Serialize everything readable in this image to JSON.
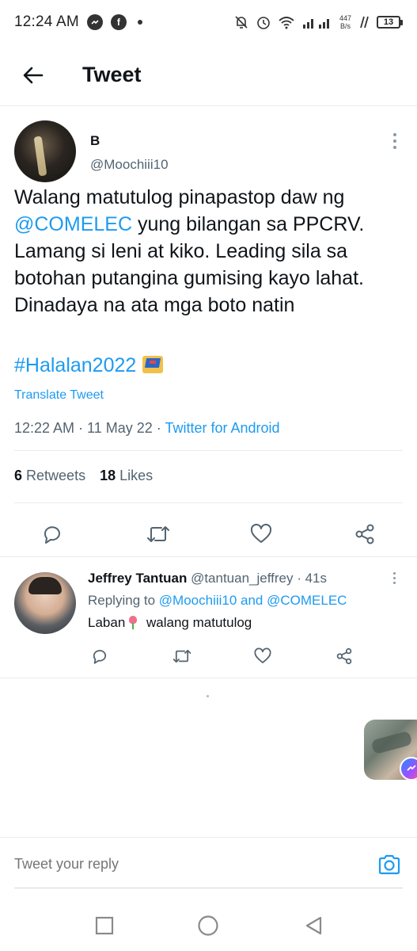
{
  "status_bar": {
    "time": "12:24 AM",
    "messenger_icon": "messenger-icon",
    "facebook_icon": "facebook-icon",
    "facebook_glyph": "f",
    "net_speed_value": "447",
    "net_speed_unit": "B/s",
    "battery": "13"
  },
  "header": {
    "title": "Tweet",
    "back_icon": "arrow-left-icon"
  },
  "tweet": {
    "display_name": "B",
    "handle": "@Moochiii10",
    "text_part1": "Walang matutulog pinapastop daw ng ",
    "mention": "@COMELEC",
    "text_part2": "  yung bilangan sa PPCRV. Lamang si leni at kiko. Leading sila sa botohan putangina gumising kayo lahat. Dinadaya na ata mga boto natin",
    "hashtag": "#Halalan2022",
    "translate": "Translate Tweet",
    "time_date": "12:22 AM · 11 May 22 · ",
    "source": "Twitter for Android",
    "retweets_count": "6",
    "retweets_label": "Retweets",
    "likes_count": "18",
    "likes_label": "Likes"
  },
  "reply": {
    "name": "Jeffrey Tantuan",
    "handle_time": "@tantuan_jeffrey · 41s",
    "replying_prefix": "Replying to ",
    "replying_to": "@Moochiii10 and @COMELEC",
    "text_part1": "Laban",
    "text_part2": " walang matutulog"
  },
  "reply_bar": {
    "placeholder": "Tweet your reply"
  },
  "colors": {
    "accent": "#1d9bf0",
    "text": "#0f1419",
    "secondary": "#536471",
    "divider": "#e6ecf0"
  }
}
